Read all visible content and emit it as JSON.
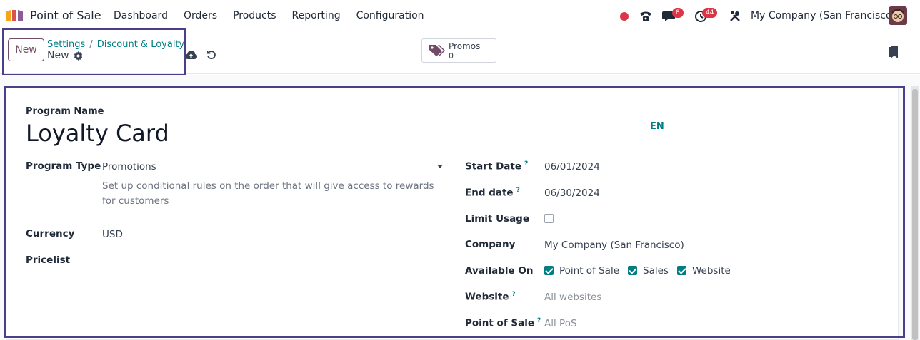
{
  "navbar": {
    "app_name": "Point of Sale",
    "menu": [
      "Dashboard",
      "Orders",
      "Products",
      "Reporting",
      "Configuration"
    ],
    "chat_count": "8",
    "activity_count": "44",
    "company": "My Company (San Francisco)"
  },
  "control": {
    "new_label": "New",
    "breadcrumb": [
      "Settings",
      "Discount & Loyalty"
    ],
    "current": "New",
    "promos_label": "Promos",
    "promos_count": "0"
  },
  "form": {
    "program_name_label": "Program Name",
    "program_name": "Loyalty Card",
    "lang": "EN",
    "program_type_label": "Program Type",
    "program_type": "Promotions",
    "program_type_desc": "Set up conditional rules on the order that will give access to rewards for customers",
    "currency_label": "Currency",
    "currency": "USD",
    "pricelist_label": "Pricelist",
    "start_date_label": "Start Date",
    "start_date": "06/01/2024",
    "end_date_label": "End date",
    "end_date": "06/30/2024",
    "limit_usage_label": "Limit Usage",
    "company_label": "Company",
    "company": "My Company (San Francisco)",
    "available_on_label": "Available On",
    "available_on": [
      "Point of Sale",
      "Sales",
      "Website"
    ],
    "website_label": "Website",
    "website_placeholder": "All websites",
    "pos_label": "Point of Sale",
    "pos_placeholder": "All PoS",
    "help_mark": "?"
  },
  "colors": {
    "primary": "#714b67",
    "link": "#017e84",
    "highlight": "#4b3f8a",
    "danger": "#dc3545"
  }
}
